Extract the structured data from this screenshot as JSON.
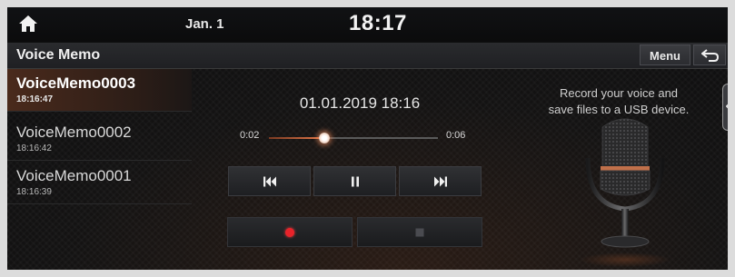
{
  "status_bar": {
    "date": "Jan. 1",
    "time": "18:17",
    "home_icon": "home-icon"
  },
  "header": {
    "title": "Voice Memo",
    "menu_label": "Menu",
    "back_icon": "back-arrow-icon"
  },
  "memo_list": {
    "items": [
      {
        "name": "VoiceMemo0003",
        "time": "18:16:47",
        "selected": true
      },
      {
        "name": "VoiceMemo0002",
        "time": "18:16:42",
        "selected": false
      },
      {
        "name": "VoiceMemo0001",
        "time": "18:16:39",
        "selected": false
      }
    ]
  },
  "player": {
    "recording_datetime": "01.01.2019 18:16",
    "elapsed": "0:02",
    "total": "0:06",
    "progress_fraction": 0.33,
    "controls": [
      "previous-track-icon",
      "pause-icon",
      "next-track-icon"
    ]
  },
  "recorder": {
    "record_icon": "record-icon",
    "stop_icon": "stop-icon"
  },
  "info": {
    "line1": "Record your voice and",
    "line2": "save files to a USB device."
  },
  "colors": {
    "accent": "#e67a4a",
    "record_red": "#e8232a",
    "selected_bg": "#4a2a1c"
  }
}
